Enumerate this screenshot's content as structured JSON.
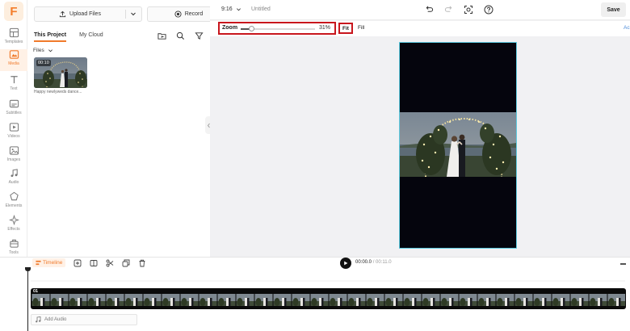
{
  "app": {
    "logo_letter": "F",
    "accent": "#F07A2B"
  },
  "sidebar": {
    "items": [
      {
        "label": "Templates",
        "icon": "templates-icon"
      },
      {
        "label": "Media",
        "icon": "media-icon",
        "active": true
      },
      {
        "label": "Text",
        "icon": "text-icon"
      },
      {
        "label": "Subtitles",
        "icon": "subtitles-icon"
      },
      {
        "label": "Videos",
        "icon": "videos-icon"
      },
      {
        "label": "Images",
        "icon": "images-icon"
      },
      {
        "label": "Audio",
        "icon": "audio-icon"
      },
      {
        "label": "Elements",
        "icon": "elements-icon"
      },
      {
        "label": "Effects",
        "icon": "effects-icon"
      },
      {
        "label": "Tools",
        "icon": "tools-icon"
      }
    ]
  },
  "media_panel": {
    "upload_label": "Upload Files",
    "record_label": "Record",
    "tabs": [
      {
        "label": "This Project",
        "active": true
      },
      {
        "label": "My Cloud"
      }
    ],
    "files_label": "Files",
    "file": {
      "duration": "00:10",
      "name": "Happy newlyweds dance..."
    }
  },
  "header": {
    "aspect_ratio": "9:16",
    "document_title": "Untitled",
    "save_label": "Save"
  },
  "canvas_toolbar": {
    "zoom_label": "Zoom",
    "zoom_value": "31%",
    "zoom_fraction": 0.31,
    "fit_label": "Fit",
    "fill_label": "Fill",
    "right_label": "Ac"
  },
  "timeline": {
    "label": "Timeline",
    "current_time": "00:00.0",
    "separator": " / ",
    "total_time": "00:11.0",
    "clip_label": "01",
    "add_audio_label": "Add Audio"
  }
}
